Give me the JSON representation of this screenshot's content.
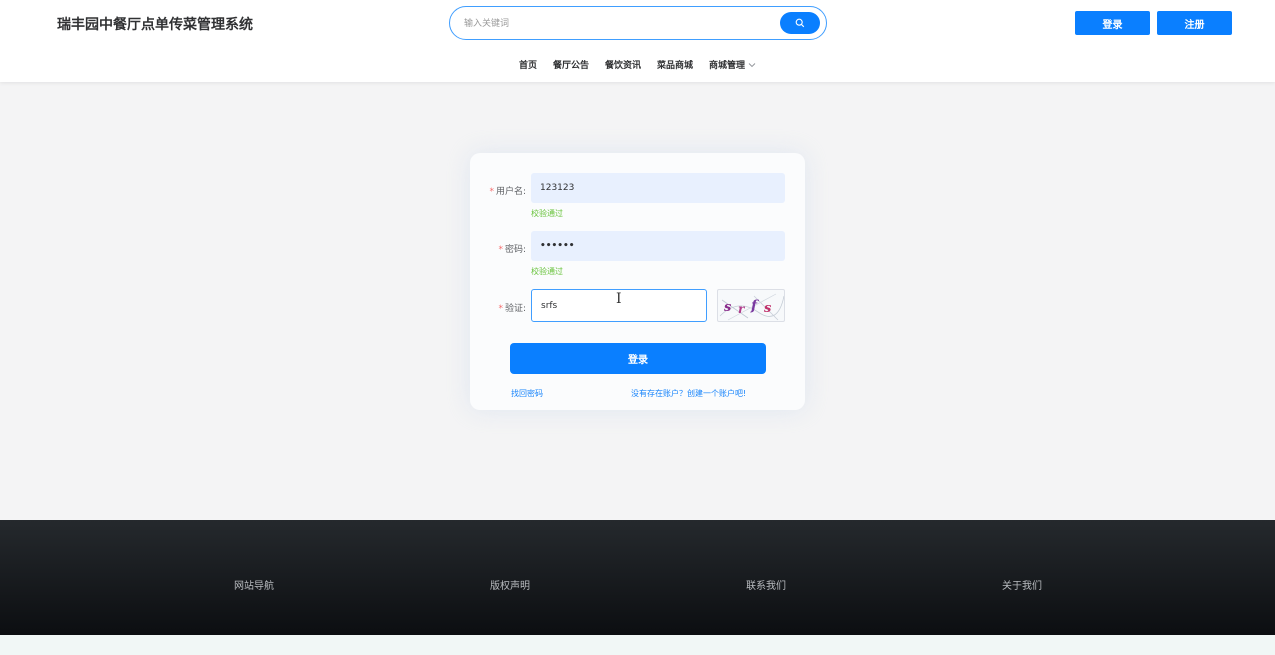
{
  "header": {
    "title": "瑞丰园中餐厅点单传菜管理系统",
    "search_placeholder": "输入关键词",
    "login_label": "登录",
    "register_label": "注册",
    "accent_color": "#0a7fff"
  },
  "nav": {
    "items": [
      "首页",
      "餐厅公告",
      "餐饮资讯",
      "菜品商城",
      "商城管理"
    ]
  },
  "login_form": {
    "username_label": "用户名:",
    "username_value": "123123",
    "username_status": "校验通过",
    "password_label": "密码:",
    "password_value": "••••••",
    "password_status": "校验通过",
    "captcha_label": "验证:",
    "captcha_value": "srfs",
    "captcha_image_text": "s r f s",
    "submit_label": "登录",
    "forgot_link": "找回密码",
    "register_link": "没有存在账户？创建一个账户吧!"
  },
  "footer": {
    "items": [
      "网站导航",
      "版权声明",
      "联系我们",
      "关于我们"
    ]
  }
}
